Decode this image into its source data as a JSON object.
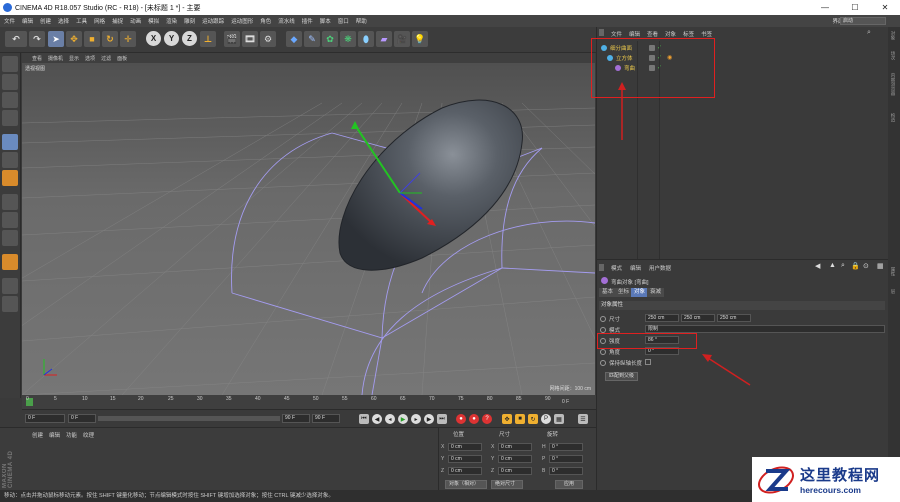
{
  "window": {
    "title": "CINEMA 4D R18.057 Studio (RC - R18) - [未标题 1 *] - 主要",
    "minimize": "—",
    "maximize": "☐",
    "close": "✕"
  },
  "menubar": {
    "items": [
      "文件",
      "编辑",
      "创建",
      "选择",
      "工具",
      "网格",
      "捕捉",
      "动画",
      "模拟",
      "渲染",
      "雕刻",
      "运动跟踪",
      "运动图形",
      "角色",
      "流水线",
      "插件",
      "脚本",
      "窗口",
      "帮助"
    ],
    "layout_label": "界面:",
    "layout_value": "启动"
  },
  "viewport": {
    "menu": [
      "查看",
      "摄像机",
      "显示",
      "选项",
      "过滤",
      "面板"
    ],
    "title": "透视视图",
    "grid_distance": "网格间距：100 cm"
  },
  "timeline": {
    "ticks": [
      "0",
      "5",
      "10",
      "15",
      "20",
      "25",
      "30",
      "35",
      "40",
      "45",
      "50",
      "55",
      "60",
      "65",
      "70",
      "75",
      "80",
      "85",
      "90"
    ],
    "frame_end_label": "0 F",
    "current_frame": "0 F",
    "start_field": "0 F",
    "end_field": "90 F",
    "end_field2": "90 F"
  },
  "materials": {
    "menu": [
      "创建",
      "编辑",
      "功能",
      "纹理"
    ],
    "logo": "MAXON CINEMA 4D"
  },
  "coordinates": {
    "headers": [
      "位置",
      "尺寸",
      "旋转"
    ],
    "rows": [
      {
        "axis": "X",
        "pos": "0 cm",
        "size_axis": "X",
        "size": "0 cm",
        "rot_axis": "H",
        "rot": "0 °"
      },
      {
        "axis": "Y",
        "pos": "0 cm",
        "size_axis": "Y",
        "size": "0 cm",
        "rot_axis": "P",
        "rot": "0 °"
      },
      {
        "axis": "Z",
        "pos": "0 cm",
        "size_axis": "Z",
        "size": "0 cm",
        "rot_axis": "B",
        "rot": "0 °"
      }
    ],
    "mode_select": "对象（相对）",
    "size_select": "绝对尺寸",
    "apply": "应用"
  },
  "status": {
    "text": "移动：点击并拖动鼠标移动元素。按住 SHIFT 键量化移动；节点编辑模式时按住 SHIFT 键增加选择对象；按住 CTRL 键减少选择对象。"
  },
  "objects": {
    "menu": [
      "文件",
      "编辑",
      "查看",
      "对象",
      "标签",
      "书签"
    ],
    "tree": [
      {
        "name": "细分曲面",
        "color": "#4fb0e6",
        "indent": 0
      },
      {
        "name": "立方体",
        "color": "#4fb0e6",
        "indent": 1
      },
      {
        "name": "弯曲",
        "color": "#a36fd6",
        "indent": 2
      }
    ]
  },
  "attributes": {
    "menu": [
      "模式",
      "编辑",
      "用户数据"
    ],
    "object_name": "弯曲对象 [弯曲]",
    "tabs": [
      "基本",
      "坐标",
      "对象",
      "衰减"
    ],
    "active_tab": "对象",
    "section": "对象属性",
    "size_label": "尺寸",
    "size_values": [
      "250 cm",
      "250 cm",
      "250 cm"
    ],
    "mode_label": "模式",
    "mode_value": "限制",
    "strength_label": "强度",
    "strength_value": "86 °",
    "angle_label": "角度",
    "angle_value": "0 °",
    "keep_length_label": "保持纵轴长度",
    "fit_button": "匹配到父级"
  },
  "right_strip": [
    "对象",
    "场次",
    "内容浏览器",
    "构造",
    "属性",
    "层"
  ],
  "watermark": {
    "cn": "这里教程网",
    "url": "herecours.com"
  },
  "toolbar": {
    "axis_x": "X",
    "axis_y": "Y",
    "axis_z": "Z"
  }
}
